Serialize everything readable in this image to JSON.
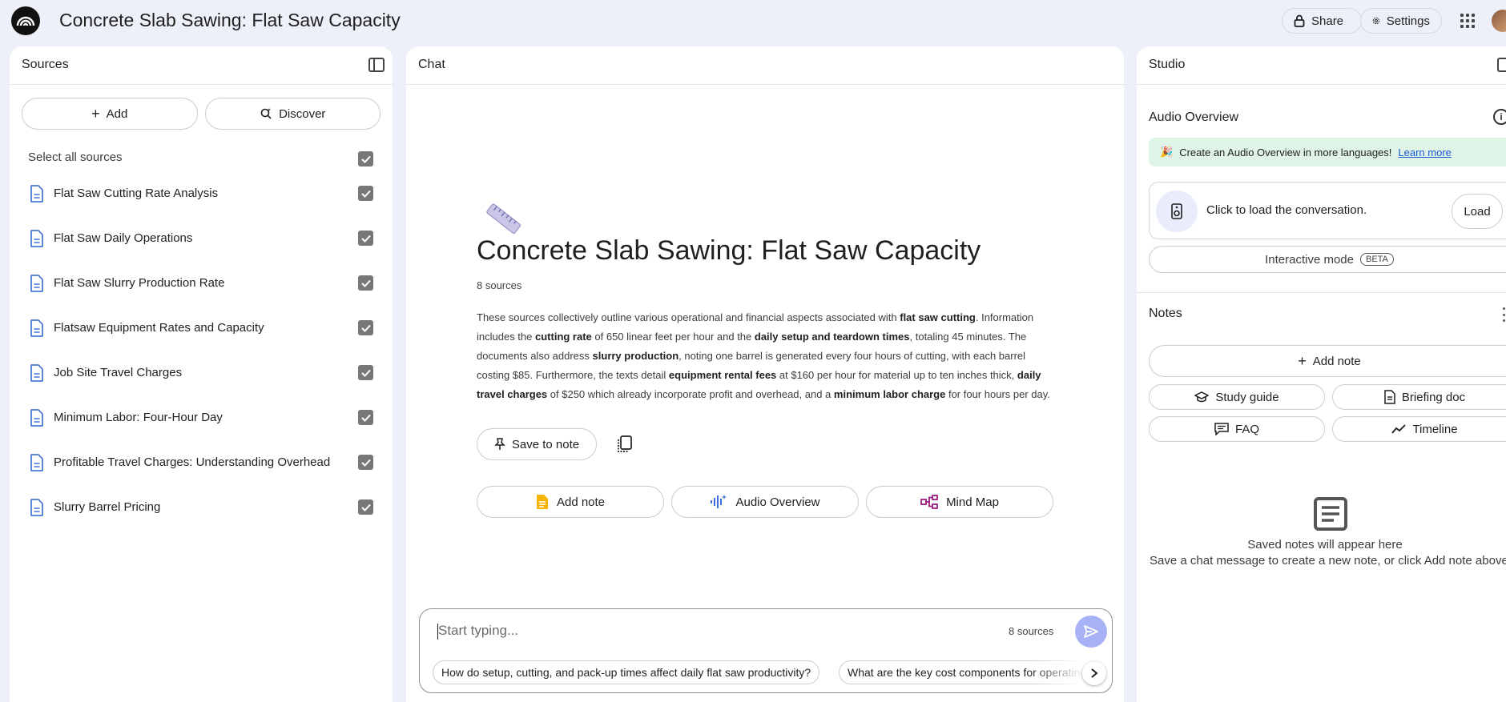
{
  "header": {
    "title": "Concrete Slab Sawing: Flat Saw Capacity",
    "share_label": "Share",
    "settings_label": "Settings"
  },
  "sources": {
    "title": "Sources",
    "add_label": "Add",
    "discover_label": "Discover",
    "select_all_label": "Select all sources",
    "items": [
      {
        "label": "Flat Saw Cutting Rate Analysis",
        "checked": true
      },
      {
        "label": "Flat Saw Daily Operations",
        "checked": true
      },
      {
        "label": "Flat Saw Slurry Production Rate",
        "checked": true
      },
      {
        "label": "Flatsaw Equipment Rates and Capacity",
        "checked": true
      },
      {
        "label": "Job Site Travel Charges",
        "checked": true
      },
      {
        "label": "Minimum Labor: Four-Hour Day",
        "checked": true
      },
      {
        "label": "Profitable Travel Charges: Understanding Overhead",
        "checked": true
      },
      {
        "label": "Slurry Barrel Pricing",
        "checked": true
      }
    ]
  },
  "chat": {
    "title": "Chat",
    "notebook_title": "Concrete Slab Sawing: Flat Saw Capacity",
    "source_count": "8 sources",
    "summary_parts": [
      {
        "text": "These sources collectively outline various operational and financial aspects associated with ",
        "bold": false
      },
      {
        "text": "flat saw cutting",
        "bold": true
      },
      {
        "text": ". Information includes the ",
        "bold": false
      },
      {
        "text": "cutting rate",
        "bold": true
      },
      {
        "text": " of 650 linear feet per hour and the ",
        "bold": false
      },
      {
        "text": "daily setup and teardown times",
        "bold": true
      },
      {
        "text": ", totaling 45 minutes. The documents also address ",
        "bold": false
      },
      {
        "text": "slurry production",
        "bold": true
      },
      {
        "text": ", noting one barrel is generated every four hours of cutting, with each barrel costing $85. Furthermore, the texts detail ",
        "bold": false
      },
      {
        "text": "equipment rental fees",
        "bold": true
      },
      {
        "text": " at $160 per hour for material up to ten inches thick, ",
        "bold": false
      },
      {
        "text": "daily travel charges",
        "bold": true
      },
      {
        "text": " of $250 which already incorporate profit and overhead, and a ",
        "bold": false
      },
      {
        "text": "minimum labor charge",
        "bold": true
      },
      {
        "text": " for four hours per day.",
        "bold": false
      }
    ],
    "save_to_note_label": "Save to note",
    "actions": {
      "add_note": "Add note",
      "audio_overview": "Audio Overview",
      "mind_map": "Mind Map"
    },
    "composer": {
      "placeholder": "Start typing...",
      "source_count": "8 sources"
    },
    "suggestions": [
      "How do setup, cutting, and pack-up times affect daily flat saw productivity?",
      "What are the key cost components for operating a flat saw?"
    ]
  },
  "studio": {
    "title": "Studio",
    "audio_overview_title": "Audio Overview",
    "banner_text": "Create an Audio Overview in more languages!",
    "banner_link": "Learn more",
    "load_text": "Click to load the conversation.",
    "load_label": "Load",
    "interactive_label": "Interactive mode",
    "beta_label": "BETA",
    "notes_title": "Notes",
    "add_note_label": "Add note",
    "buttons": {
      "study_guide": "Study guide",
      "briefing_doc": "Briefing doc",
      "faq": "FAQ",
      "timeline": "Timeline"
    },
    "empty_title": "Saved notes will appear here",
    "empty_sub": "Save a chat message to create a new note, or click Add note above."
  },
  "colors": {
    "background": "#eef0f9",
    "accent": "#a7b1f5",
    "doc_icon": "#4a7bd6",
    "banner_bg": "#dff3e6",
    "link": "#1a57d6"
  }
}
